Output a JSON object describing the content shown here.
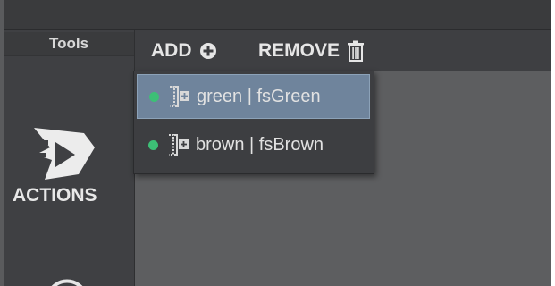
{
  "sidebar": {
    "title": "Tools",
    "actions_label": "ACTIONS"
  },
  "toolbar": {
    "add_label": "ADD",
    "remove_label": "REMOVE"
  },
  "dropdown": {
    "items": [
      {
        "label": "green | fsGreen",
        "status_color": "#3dbf76",
        "selected": true,
        "icon": "add-resource-icon"
      },
      {
        "label": "brown | fsBrown",
        "status_color": "#3dbf76",
        "selected": false,
        "icon": "add-resource-icon"
      }
    ]
  },
  "colors": {
    "accent_selection": "#6f849c",
    "status_green": "#3dbf76"
  }
}
